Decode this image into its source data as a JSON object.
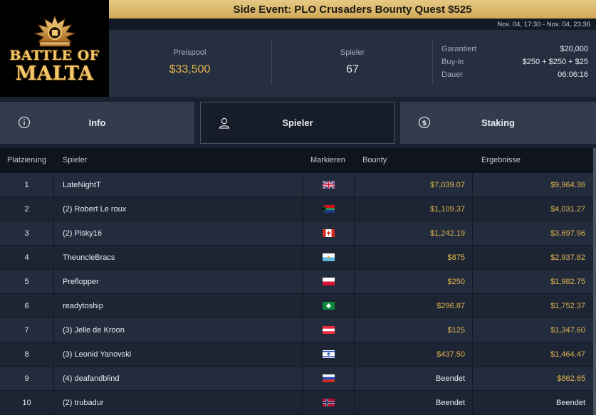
{
  "logo": {
    "line1": "BATTLE OF",
    "line2": "MALTA"
  },
  "title": "Side Event: PLO Crusaders Bounty Quest $525",
  "dates": "Nov. 04, 17:30 - Nov. 04, 23:36",
  "stats": {
    "prize_pool_label": "Preispool",
    "prize_pool_value": "$33,500",
    "players_label": "Spieler",
    "players_value": "67",
    "details": [
      {
        "key": "Garantiert",
        "value": "$20,000"
      },
      {
        "key": "Buy-in",
        "value": "$250 + $250 + $25"
      },
      {
        "key": "Dauer",
        "value": "06:06:16"
      }
    ]
  },
  "tabs": [
    {
      "label": "Info",
      "icon": "info-icon",
      "active": false
    },
    {
      "label": "Spieler",
      "icon": "user-icon",
      "active": true
    },
    {
      "label": "Staking",
      "icon": "dollar-coin-icon",
      "active": false
    }
  ],
  "table": {
    "headers": [
      "Platzierung",
      "Spieler",
      "Markieren",
      "Bounty",
      "Ergebnisse"
    ],
    "rows": [
      {
        "place": "1",
        "name": "LateNightT",
        "flag": "gb",
        "bounty": "$7,039.07",
        "result": "$9,964.36"
      },
      {
        "place": "2",
        "name": "(2) Robert Le roux",
        "flag": "za",
        "bounty": "$1,109.37",
        "result": "$4,031.27"
      },
      {
        "place": "3",
        "name": "(2) Pisky16",
        "flag": "ca",
        "bounty": "$1,242.19",
        "result": "$3,697.96"
      },
      {
        "place": "4",
        "name": "TheuncleBracs",
        "flag": "sm",
        "bounty": "$875",
        "result": "$2,937.82"
      },
      {
        "place": "5",
        "name": "Preflopper",
        "flag": "pl",
        "bounty": "$250",
        "result": "$1,982.75"
      },
      {
        "place": "6",
        "name": "readytoship",
        "flag": "green-club",
        "bounty": "$296.87",
        "result": "$1,752.37"
      },
      {
        "place": "7",
        "name": "(3) Jelle de Kroon",
        "flag": "at",
        "bounty": "$125",
        "result": "$1,347.60"
      },
      {
        "place": "8",
        "name": "(3) Leonid Yanovski",
        "flag": "il",
        "bounty": "$437.50",
        "result": "$1,464.47"
      },
      {
        "place": "9",
        "name": "(4) deafandblind",
        "flag": "ru",
        "bounty": "Beendet",
        "result": "$862.65"
      },
      {
        "place": "10",
        "name": "(2) trubadur",
        "flag": "no",
        "bounty": "Beendet",
        "result": "Beendet"
      }
    ]
  },
  "colors": {
    "accent": "#e2b44f",
    "title_bar": "#d9b768",
    "background": "#1a2130"
  }
}
